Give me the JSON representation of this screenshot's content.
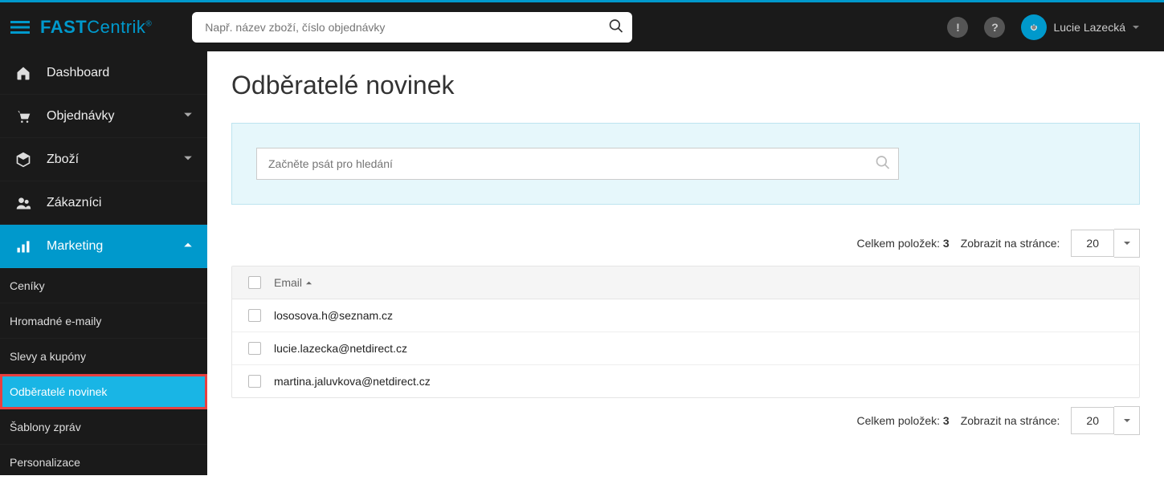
{
  "header": {
    "logo_bold": "FAST",
    "logo_light": "Centrik",
    "logo_reg": "®",
    "search_placeholder": "Např. název zboží, číslo objednávky",
    "user_name": "Lucie Lazecká"
  },
  "sidebar": {
    "items": [
      {
        "label": "Dashboard",
        "icon": "home",
        "expandable": false
      },
      {
        "label": "Objednávky",
        "icon": "cart",
        "expandable": true
      },
      {
        "label": "Zboží",
        "icon": "tag",
        "expandable": true
      },
      {
        "label": "Zákazníci",
        "icon": "users",
        "expandable": false
      },
      {
        "label": "Marketing",
        "icon": "chart",
        "expandable": true,
        "active": true
      }
    ],
    "sub": [
      {
        "label": "Ceníky"
      },
      {
        "label": "Hromadné e-maily"
      },
      {
        "label": "Slevy a kupóny"
      },
      {
        "label": "Odběratelé novinek",
        "selected": true
      },
      {
        "label": "Šablony zpráv"
      },
      {
        "label": "Personalizace"
      }
    ]
  },
  "page": {
    "title": "Odběratelé novinek",
    "filter_placeholder": "Začněte psát pro hledání",
    "total_label": "Celkem položek:",
    "total_count": "3",
    "per_page_label": "Zobrazit na stránce:",
    "per_page_value": "20",
    "column_header": "Email",
    "rows": [
      {
        "email": "lososova.h@seznam.cz"
      },
      {
        "email": "lucie.lazecka@netdirect.cz"
      },
      {
        "email": "martina.jaluvkova@netdirect.cz"
      }
    ]
  }
}
